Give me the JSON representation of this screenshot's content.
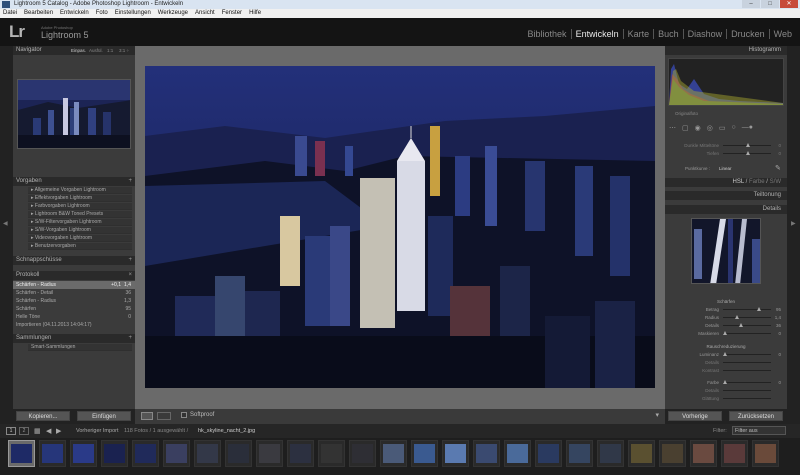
{
  "window": {
    "title": "Lightroom 5 Catalog - Adobe Photoshop Lightroom - Entwickeln",
    "minimize": "–",
    "maximize": "□",
    "close": "✕"
  },
  "menu": [
    "Datei",
    "Bearbeiten",
    "Entwickeln",
    "Foto",
    "Einstellungen",
    "Werkzeuge",
    "Ansicht",
    "Fenster",
    "Hilfe"
  ],
  "identity": {
    "logo": "Lr",
    "sub": "Adobe Photoshop",
    "name": "Lightroom 5"
  },
  "modules": [
    "Bibliothek",
    "Entwickeln",
    "Karte",
    "Buch",
    "Diashow",
    "Drucken",
    "Web"
  ],
  "active_module": "Entwickeln",
  "navigator": {
    "title": "Navigator",
    "zoom": [
      "Einpas.",
      "Ausfül.",
      "1:1",
      "3:1 ÷"
    ]
  },
  "presets": {
    "title": "Vorgaben",
    "items": [
      "Allgemeine Vorgaben Lightroom",
      "Effektvorgaben Lightroom",
      "Farbvorgaben Lightroom",
      "Lightroom B&W Toned Presets",
      "S/W-Filtervorgaben Lightroom",
      "S/W-Vorgaben Lightroom",
      "Videovorgaben Lightroom",
      "Benutzervorgaben"
    ]
  },
  "snapshots": {
    "title": "Schnappschüsse"
  },
  "history": {
    "title": "Protokoll",
    "items": [
      {
        "label": "Schärfen - Radius",
        "v1": "+0,1",
        "v2": "1,4"
      },
      {
        "label": "Schärfen - Detail",
        "v1": "",
        "v2": "36"
      },
      {
        "label": "Schärfen - Radius",
        "v1": "",
        "v2": "1,3"
      },
      {
        "label": "Schärfen",
        "v1": "",
        "v2": "95"
      },
      {
        "label": "Helle Töne",
        "v1": "",
        "v2": "0"
      },
      {
        "label": "Importieren (04.11.2013 14:04:17)",
        "v1": "",
        "v2": ""
      }
    ]
  },
  "collections": {
    "title": "Sammlungen",
    "items": [
      "Smart-Sammlungen"
    ]
  },
  "left_buttons": {
    "copy": "Kopieren...",
    "paste": "Einfügen"
  },
  "right_panel": {
    "histogram_title": "Histogramm",
    "original_photo": "Originalfoto",
    "tone_sliders": [
      {
        "label": "Dunkle Mitteltöne",
        "value": "0"
      },
      {
        "label": "Tiefen",
        "value": "0"
      }
    ],
    "point_curve_label": "Punktkurve :",
    "point_curve_value": "Linear",
    "hsl_tabs": [
      "HSL",
      "Farbe",
      "S/W"
    ],
    "split_toning": "Teiltonung",
    "details": "Details",
    "sharpen_title": "Schärfen",
    "sharpen": [
      {
        "label": "Betrag",
        "value": "95"
      },
      {
        "label": "Radius",
        "value": "1,4"
      },
      {
        "label": "Details",
        "value": "36"
      },
      {
        "label": "Maskieren",
        "value": "0"
      }
    ],
    "nr_title": "Rauschreduzierung",
    "nr": [
      {
        "label": "Luminanz",
        "value": "0"
      },
      {
        "label": "Details",
        "value": ""
      },
      {
        "label": "Kontrast",
        "value": ""
      },
      {
        "label": "Farbe",
        "value": "0"
      },
      {
        "label": "Details",
        "value": ""
      },
      {
        "label": "Glättung",
        "value": ""
      }
    ],
    "previous": "Vorherige",
    "reset": "Zurücksetzen"
  },
  "toolbar": {
    "softproof": "Softproof"
  },
  "filmbar": {
    "pages": [
      "1",
      "2"
    ],
    "source": "Vorheriger Import",
    "count": "118 Fotos / 1 ausgewählt /",
    "filename": "hk_skyline_nacht_2.jpg",
    "filter_label": "Filter:",
    "filter_value": "Filter aus"
  },
  "colors": {
    "panel": "#3b3b3b",
    "header": "#2a2a2a",
    "center": "#6a6a6a",
    "sky": "#1c2455"
  }
}
